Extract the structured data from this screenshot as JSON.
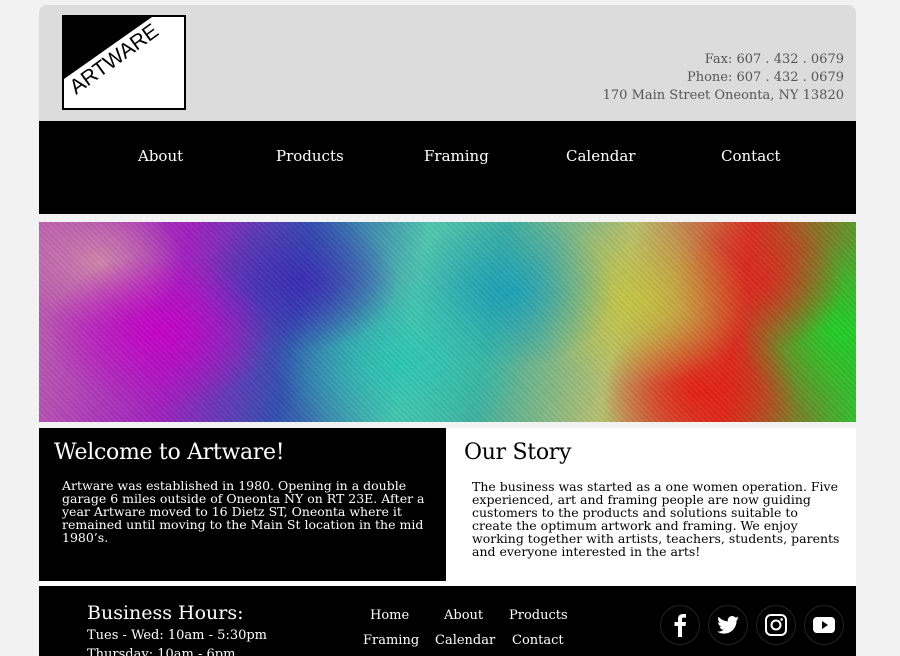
{
  "logo": {
    "text": "ARTWARE"
  },
  "contact": {
    "fax": "Fax: 607 . 432 . 0679",
    "phone": "Phone: 607 . 432 . 0679",
    "address": "170 Main Street Oneonta, NY 13820"
  },
  "nav": {
    "items": [
      {
        "label": "About"
      },
      {
        "label": "Products"
      },
      {
        "label": "Framing"
      },
      {
        "label": "Calendar"
      },
      {
        "label": "Contact"
      }
    ]
  },
  "banner": {
    "colors": [
      "#a020c0",
      "#3050b0",
      "#50c8b0",
      "#b8c070",
      "#d83020",
      "#30c030"
    ]
  },
  "welcome": {
    "title": "Welcome to Artware!",
    "body": "Artware was established in 1980. Opening in a double garage 6 miles outside of Oneonta NY on RT 23E. After a year Artware moved to 16 Dietz ST, Oneonta where it remained until moving to the Main St location in the mid 1980’s."
  },
  "story": {
    "title": "Our Story",
    "body": "The business was started as a one women operation. Five experienced, art and framing people are now guiding customers to the products and solutions suitable to create the optimum artwork and framing. We enjoy working together with artists, teachers, students, parents and everyone interested in the arts!"
  },
  "footer": {
    "hours_title": "Business Hours:",
    "hours": [
      "Tues - Wed: 10am - 5:30pm",
      "Thursday: 10am - 6pm"
    ],
    "nav": [
      {
        "label": "Home"
      },
      {
        "label": "About"
      },
      {
        "label": "Products"
      },
      {
        "label": "Framing"
      },
      {
        "label": "Calendar"
      },
      {
        "label": "Contact"
      }
    ],
    "social": [
      "facebook-icon",
      "twitter-icon",
      "instagram-icon",
      "youtube-icon"
    ]
  }
}
